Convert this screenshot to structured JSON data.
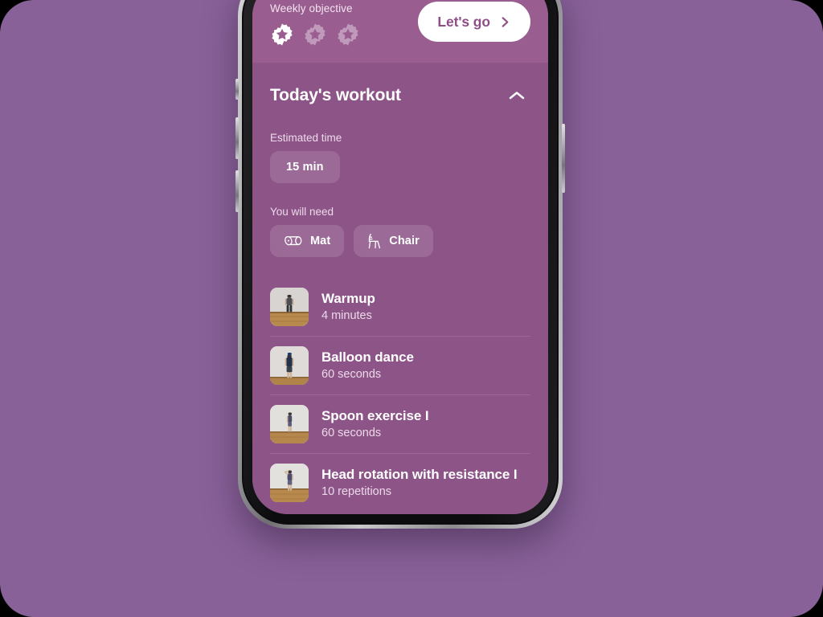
{
  "theme": {
    "page_background": "#886199",
    "header_band": "#9a5d90",
    "screen_background": "#8d5488",
    "accent_on_white": "#8e4f87",
    "text_primary": "#ffffff",
    "text_secondary": "#ecd9e9"
  },
  "header": {
    "objective_label": "Weekly objective",
    "stars": [
      {
        "name": "star-badge-1",
        "earned": true
      },
      {
        "name": "star-badge-2",
        "earned": false
      },
      {
        "name": "star-badge-3",
        "earned": false
      }
    ],
    "cta": {
      "label": "Let's go",
      "icon": "chevron-right-icon"
    }
  },
  "workout": {
    "title": "Today's workout",
    "collapse_icon": "chevron-up-icon",
    "estimated_time_label": "Estimated time",
    "estimated_time_value": "15 min",
    "equipment_label": "You will need",
    "equipment": [
      {
        "label": "Mat",
        "icon": "yoga-mat-icon"
      },
      {
        "label": "Chair",
        "icon": "chair-icon"
      }
    ],
    "exercises": [
      {
        "name": "Warmup",
        "meta": "4 minutes",
        "thumb": "warmup-thumbnail"
      },
      {
        "name": "Balloon dance",
        "meta": "60 seconds",
        "thumb": "balloon-dance-thumbnail"
      },
      {
        "name": "Spoon exercise I",
        "meta": "60 seconds",
        "thumb": "spoon-exercise-thumbnail"
      },
      {
        "name": "Head rotation with resistance I",
        "meta": "10 repetitions",
        "thumb": "head-rotation-thumbnail"
      }
    ]
  }
}
